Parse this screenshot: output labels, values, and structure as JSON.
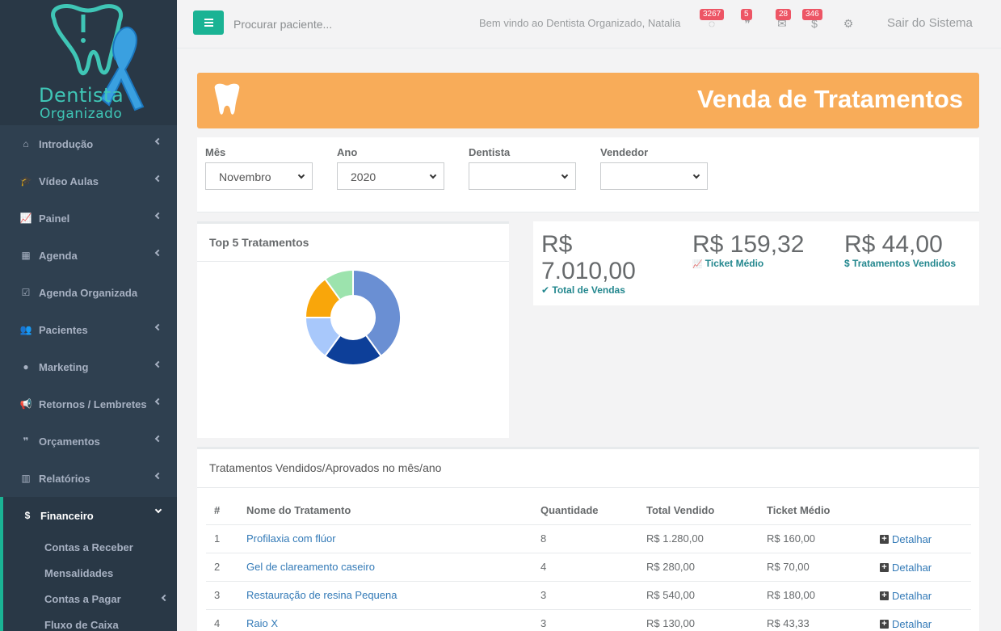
{
  "brand": {
    "name_line1": "Dentista",
    "name_line2": "Organizado"
  },
  "sidebar": {
    "items": [
      {
        "label": "Introdução",
        "icon": "home-icon",
        "glyph": "⌂"
      },
      {
        "label": "Vídeo Aulas",
        "icon": "graduation-cap-icon",
        "glyph": "🎓"
      },
      {
        "label": "Painel",
        "icon": "line-chart-icon",
        "glyph": "📈"
      },
      {
        "label": "Agenda",
        "icon": "calendar-icon",
        "glyph": "▦"
      },
      {
        "label": "Agenda Organizada",
        "icon": "calendar-check-icon",
        "glyph": "☑"
      },
      {
        "label": "Pacientes",
        "icon": "users-icon",
        "glyph": "👥"
      },
      {
        "label": "Marketing",
        "icon": "comment-icon",
        "glyph": "●"
      },
      {
        "label": "Retornos / Lembretes",
        "icon": "bullhorn-icon",
        "glyph": "📢"
      },
      {
        "label": "Orçamentos",
        "icon": "quote-icon",
        "glyph": "❞"
      },
      {
        "label": "Relatórios",
        "icon": "bar-chart-icon",
        "glyph": "▥"
      }
    ],
    "active": {
      "label": "Financeiro",
      "icon": "dollar-icon",
      "glyph": "$"
    },
    "subitems": [
      "Contas a Receber",
      "Mensalidades",
      "Contas a Pagar",
      "Fluxo de Caixa"
    ]
  },
  "topbar": {
    "search_placeholder": "Procurar paciente...",
    "welcome": "Bem vindo ao Dentista Organizado, Natalia",
    "badges": [
      {
        "icon": "whatsapp-icon",
        "glyph": "◌",
        "count": "3267"
      },
      {
        "icon": "quote-icon",
        "glyph": "❞",
        "count": "5"
      },
      {
        "icon": "envelope-icon",
        "glyph": "✉",
        "count": "28"
      },
      {
        "icon": "dollar-icon",
        "glyph": "$",
        "count": "346"
      }
    ],
    "settings_glyph": "⚙",
    "logout": "Sair do Sistema"
  },
  "banner": {
    "title": "Venda de Tratamentos"
  },
  "filters": {
    "mes": {
      "label": "Mês",
      "value": "Novembro"
    },
    "ano": {
      "label": "Ano",
      "value": "2020"
    },
    "dentista": {
      "label": "Dentista",
      "value": ""
    },
    "vendedor": {
      "label": "Vendedor",
      "value": ""
    }
  },
  "chart": {
    "title": "Top 5 Tratamentos"
  },
  "chart_data": {
    "type": "pie",
    "title": "Top 5 Tratamentos",
    "values": [
      8,
      4,
      3,
      3,
      2
    ],
    "colors": [
      "#6a8fd3",
      "#0d3f99",
      "#a8c8fb",
      "#f9a60a",
      "#9ce3ad"
    ]
  },
  "stats": [
    {
      "value": "R$ 7.010,00",
      "label": "Total de Vendas",
      "icon": "check-icon",
      "glyph": "✔"
    },
    {
      "value": "R$ 159,32",
      "label": "Ticket Médio",
      "icon": "line-chart-icon",
      "glyph": "📈"
    },
    {
      "value": "R$ 44,00",
      "label": "Tratamentos Vendidos",
      "icon": "money-icon",
      "glyph": "$"
    }
  ],
  "table": {
    "title": "Tratamentos Vendidos/Aprovados no mês/ano",
    "headers": [
      "#",
      "Nome do Tratamento",
      "Quantidade",
      "Total Vendido",
      "Ticket Médio",
      ""
    ],
    "rows": [
      {
        "n": "1",
        "name": "Profilaxia com flúor",
        "qty": "8",
        "total": "R$ 1.280,00",
        "ticket": "R$ 160,00",
        "action": "Detalhar"
      },
      {
        "n": "2",
        "name": "Gel de clareamento caseiro",
        "qty": "4",
        "total": "R$ 280,00",
        "ticket": "R$ 70,00",
        "action": "Detalhar"
      },
      {
        "n": "3",
        "name": "Restauração de resina Pequena",
        "qty": "3",
        "total": "R$ 540,00",
        "ticket": "R$ 180,00",
        "action": "Detalhar"
      },
      {
        "n": "4",
        "name": "Raio X",
        "qty": "3",
        "total": "R$ 130,00",
        "ticket": "R$ 43,33",
        "action": "Detalhar"
      }
    ]
  }
}
